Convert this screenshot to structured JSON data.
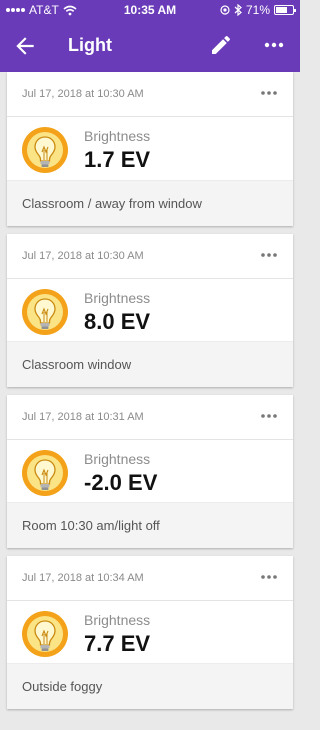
{
  "status_bar": {
    "carrier": "AT&T",
    "time": "10:35 AM",
    "battery_percent": "71%",
    "battery_level": 0.71,
    "icons": [
      "signal-icon",
      "wifi-icon",
      "location-icon",
      "bluetooth-icon",
      "battery-icon"
    ]
  },
  "app_bar": {
    "title": "Light",
    "icons": [
      "back-arrow-icon",
      "edit-pencil-icon",
      "more-horizontal-icon"
    ],
    "color": "#6a3bb8"
  },
  "entries": [
    {
      "timestamp": "Jul 17, 2018 at 10:30 AM",
      "label": "Brightness",
      "value": "1.7 EV",
      "note": "Classroom / away from window"
    },
    {
      "timestamp": "Jul 17, 2018 at 10:30 AM",
      "label": "Brightness",
      "value": "8.0 EV",
      "note": "Classroom window"
    },
    {
      "timestamp": "Jul 17, 2018 at 10:31 AM",
      "label": "Brightness",
      "value": "-2.0 EV",
      "note": "Room 10:30 am/light off"
    },
    {
      "timestamp": "Jul 17, 2018 at 10:34 AM",
      "label": "Brightness",
      "value": "7.7 EV",
      "note": "Outside foggy"
    }
  ],
  "colors": {
    "accent": "#6a3bb8",
    "bulb_outer": "#f3a21a",
    "bulb_inner": "#fbe486"
  }
}
